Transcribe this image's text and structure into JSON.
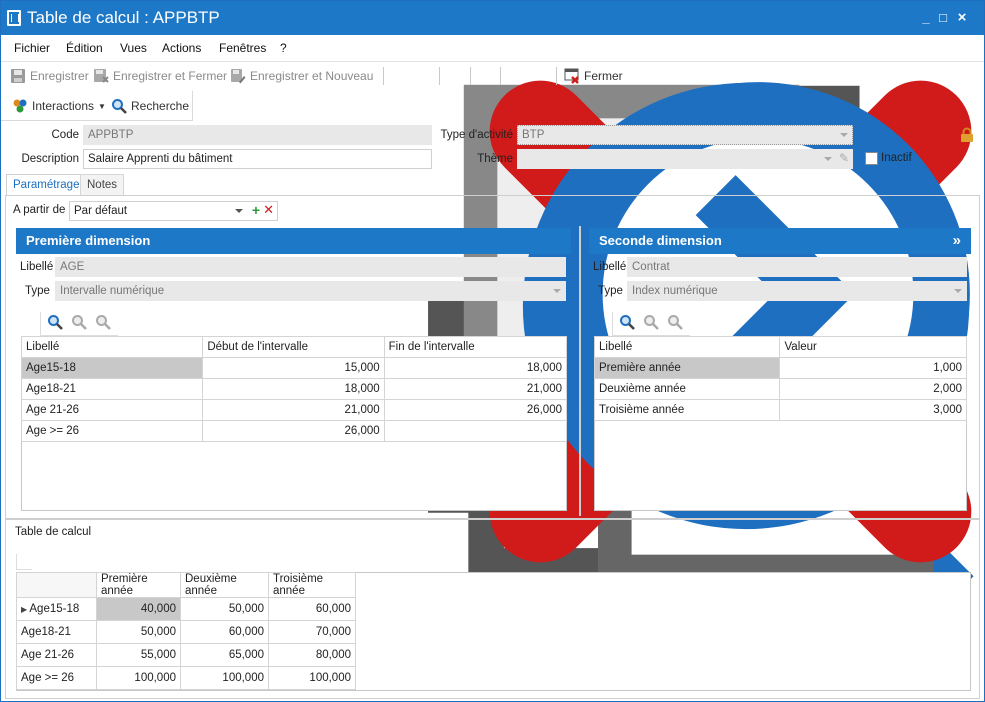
{
  "window": {
    "title": "Table de calcul : APPBTP",
    "min": "_",
    "max": "□",
    "close": "×"
  },
  "menu": [
    "Fichier",
    "Édition",
    "Vues",
    "Actions",
    "Fenêtres",
    "?"
  ],
  "toolbar": {
    "save": "Enregistrer",
    "save_close": "Enregistrer et Fermer",
    "save_new": "Enregistrer et Nouveau",
    "close": "Fermer"
  },
  "subbar": {
    "interactions": "Interactions",
    "search": "Recherche"
  },
  "form": {
    "code_label": "Code",
    "code_value": "APPBTP",
    "description_label": "Description",
    "description_value": "Salaire Apprenti du bâtiment",
    "activity_label": "Type d'activité",
    "activity_value": "BTP",
    "theme_label": "Thème",
    "theme_value": "",
    "inactive_label": "Inactif"
  },
  "tabs": [
    "Paramétrage",
    "Notes"
  ],
  "from": {
    "label": "A partir de",
    "value": "Par défaut"
  },
  "dim1": {
    "title": "Première dimension",
    "libelle_label": "Libellé",
    "libelle_value": "AGE",
    "type_label": "Type",
    "type_value": "Intervalle numérique",
    "headers": [
      "Libellé",
      "Début de l'intervalle",
      "Fin de l'intervalle"
    ],
    "rows": [
      [
        "Age15-18",
        "15,000",
        "18,000"
      ],
      [
        "Age18-21",
        "18,000",
        "21,000"
      ],
      [
        "Age 21-26",
        "21,000",
        "26,000"
      ],
      [
        "Age >= 26",
        "26,000",
        ""
      ]
    ]
  },
  "dim2": {
    "title": "Seconde dimension",
    "expand": "»",
    "libelle_label": "Libellé",
    "libelle_value": "Contrat",
    "type_label": "Type",
    "type_value": "Index numérique",
    "headers": [
      "Libellé",
      "Valeur"
    ],
    "rows": [
      [
        "Première année",
        "1,000"
      ],
      [
        "Deuxième année",
        "2,000"
      ],
      [
        "Troisième année",
        "3,000"
      ]
    ]
  },
  "calc": {
    "label": "Table de calcul",
    "headers": [
      "",
      "Première année",
      "Deuxième année",
      "Troisième année"
    ],
    "rows": [
      [
        "Age15-18",
        "40,000",
        "50,000",
        "60,000"
      ],
      [
        "Age18-21",
        "50,000",
        "60,000",
        "70,000"
      ],
      [
        "Age 21-26",
        "55,000",
        "65,000",
        "80,000"
      ],
      [
        "Age >= 26",
        "100,000",
        "100,000",
        "100,000"
      ]
    ]
  },
  "colors": {
    "accent": "#1e78c8",
    "selected": "#c8c8c8",
    "delete": "#d11a1a"
  }
}
